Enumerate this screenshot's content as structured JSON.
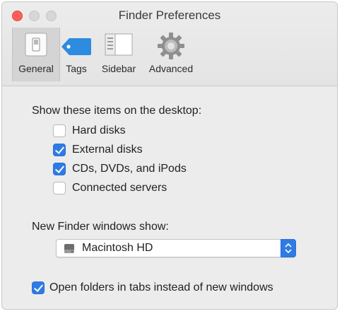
{
  "window": {
    "title": "Finder Preferences"
  },
  "toolbar": {
    "items": [
      {
        "label": "General",
        "icon": "general-switch-icon",
        "selected": true
      },
      {
        "label": "Tags",
        "icon": "tag-icon",
        "selected": false
      },
      {
        "label": "Sidebar",
        "icon": "sidebar-icon",
        "selected": false
      },
      {
        "label": "Advanced",
        "icon": "gear-icon",
        "selected": false
      }
    ]
  },
  "desktop_section": {
    "label": "Show these items on the desktop:",
    "items": [
      {
        "label": "Hard disks",
        "checked": false
      },
      {
        "label": "External disks",
        "checked": true
      },
      {
        "label": "CDs, DVDs, and iPods",
        "checked": true
      },
      {
        "label": "Connected servers",
        "checked": false
      }
    ]
  },
  "new_window": {
    "label": "New Finder windows show:",
    "selected_value": "Macintosh HD",
    "icon": "hard-drive-icon"
  },
  "tabs_option": {
    "label": "Open folders in tabs instead of new windows",
    "checked": true
  },
  "colors": {
    "accent": "#2f7be5",
    "close_button": "#fc5f57",
    "window_background": "#ececec"
  }
}
